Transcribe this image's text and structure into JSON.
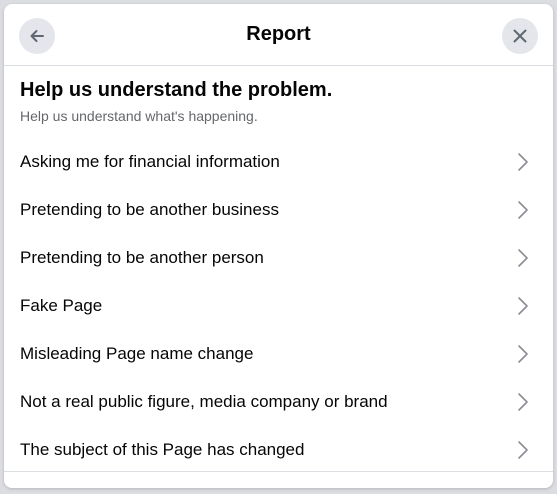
{
  "header": {
    "title": "Report",
    "back_icon": "arrow-left-icon",
    "close_icon": "close-icon"
  },
  "intro": {
    "heading": "Help us understand the problem.",
    "subtext": "Help us understand what's happening."
  },
  "options": [
    {
      "label": "Asking me for financial information",
      "icon": "chevron-right-icon"
    },
    {
      "label": "Pretending to be another business",
      "icon": "chevron-right-icon"
    },
    {
      "label": "Pretending to be another person",
      "icon": "chevron-right-icon"
    },
    {
      "label": "Fake Page",
      "icon": "chevron-right-icon"
    },
    {
      "label": "Misleading Page name change",
      "icon": "chevron-right-icon"
    },
    {
      "label": "Not a real public figure, media company or brand",
      "icon": "chevron-right-icon"
    },
    {
      "label": "The subject of this Page has changed",
      "icon": "chevron-right-icon"
    }
  ],
  "colors": {
    "text_primary": "#050505",
    "text_secondary": "#65676b",
    "button_bg": "#e4e6eb",
    "divider": "#dadde1"
  }
}
